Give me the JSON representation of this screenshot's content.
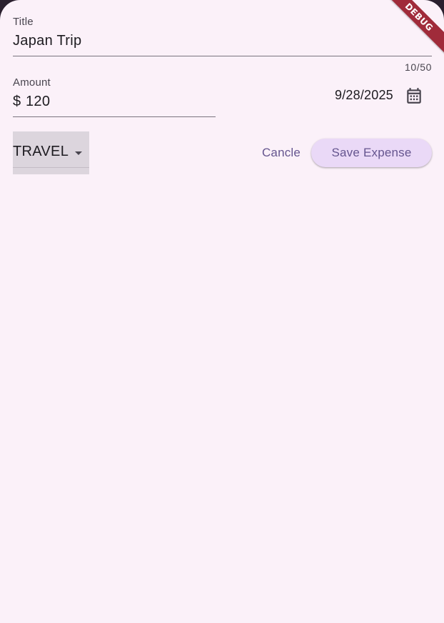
{
  "form": {
    "title": {
      "label": "Title",
      "value": "Japan Trip",
      "counter": "10/50"
    },
    "amount": {
      "label": "Amount",
      "prefix": "$",
      "value": "120"
    },
    "date": {
      "value": "9/28/2025",
      "icon": "calendar-icon"
    },
    "category": {
      "selected": "TRAVEL",
      "icon": "dropdown-arrow-icon"
    },
    "actions": {
      "cancel_label": "Cancle",
      "save_label": "Save Expense"
    }
  },
  "debug_banner": "DEBUG",
  "colors": {
    "background": "#fbf1f9",
    "primary": "#65558f",
    "save_button_bg": "#ead9f7",
    "dropdown_bg": "#dcd5dd",
    "debug_banner": "#a02b3a"
  }
}
